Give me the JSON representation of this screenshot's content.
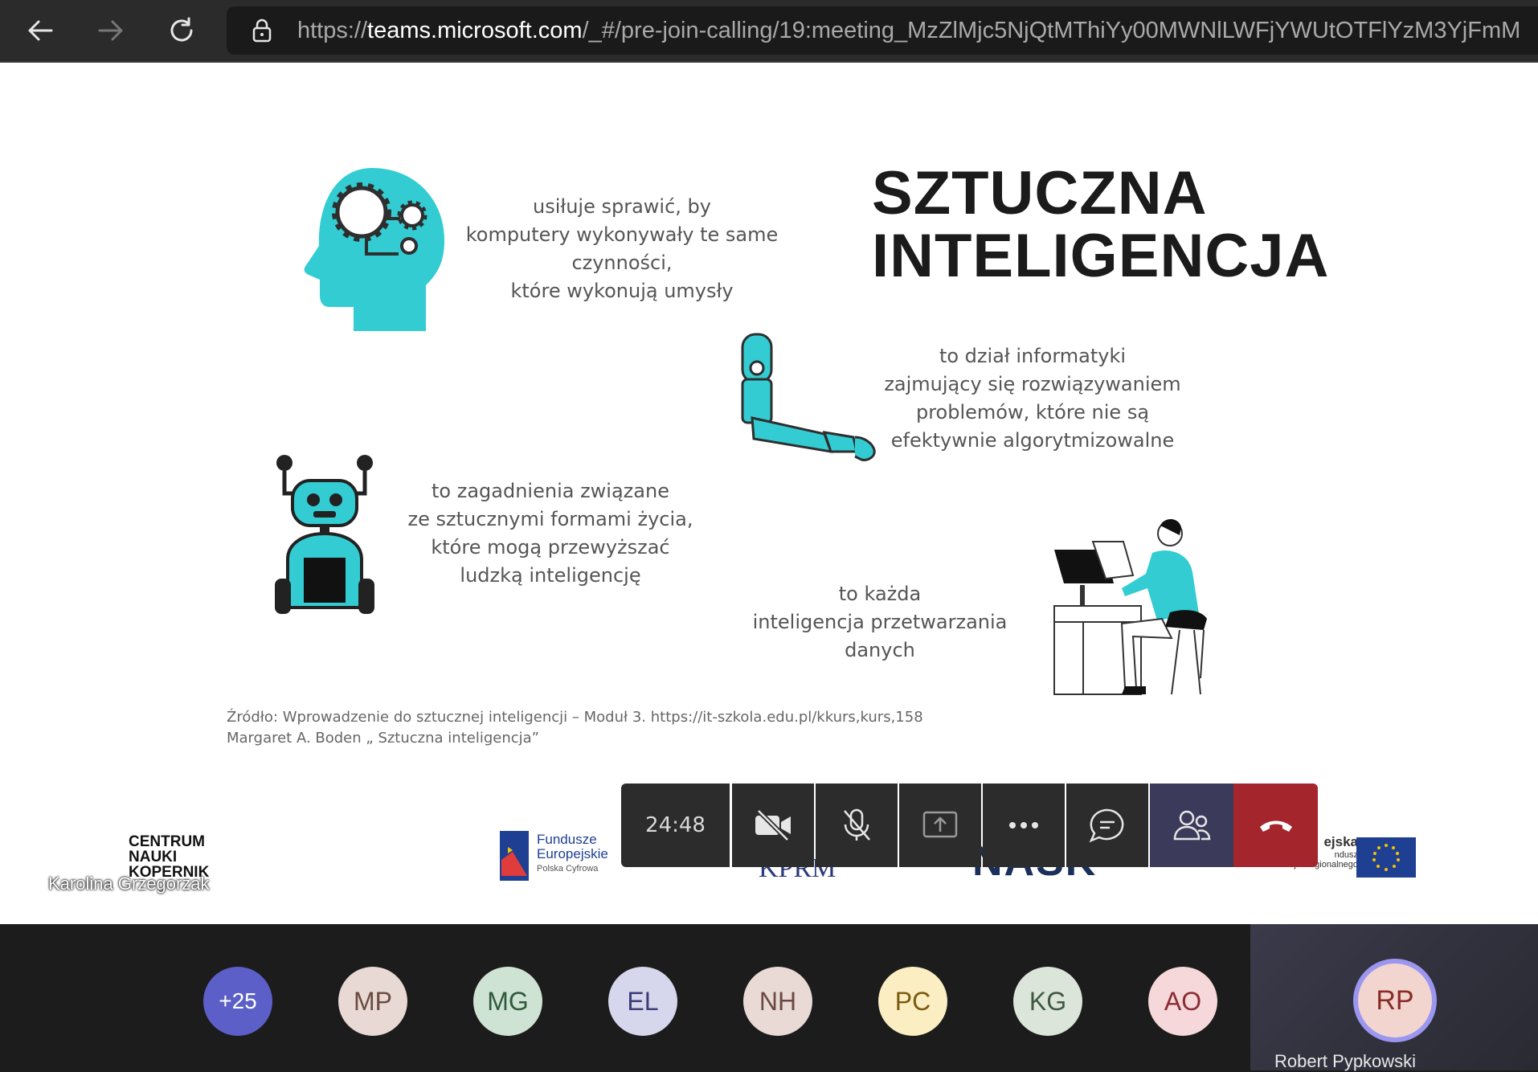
{
  "browser": {
    "url_scheme": "https://",
    "url_host": "teams.microsoft.com",
    "url_path": "/_#/pre-join-calling/19:meeting_MzZlMjc5NjQtMThiYy00MWNlLWFjYWUtOTFlYzM3YjFmM"
  },
  "slide": {
    "title_line1": "SZTUCZNA",
    "title_line2": "INTELIGENCJA",
    "text_head": [
      "usiłuje sprawić, by",
      "komputery wykonywały te same",
      "czynności,",
      "które wykonują umysły"
    ],
    "text_arm": [
      "to dział informatyki",
      "zajmujący się rozwiązywaniem",
      "problemów, które nie są",
      "efektywnie algorytmizowalne"
    ],
    "text_robot": [
      "to zagadnienia związane",
      "ze sztucznymi formami życia,",
      "które mogą przewyższać",
      "ludzką inteligencję"
    ],
    "text_person": [
      "to każda",
      "inteligencja przetwarzania",
      "danych"
    ],
    "source_line1": "Źródło: Wprowadzenie do sztucznej inteligencji – Moduł 3. https://it-szkola.edu.pl/kkurs,kurs,158",
    "source_line2": "Margaret A. Boden „ Sztuczna inteligencja”",
    "logo_cnk": [
      "CENTRUM",
      "NAUKI",
      "KOPERNIK"
    ],
    "logo_fe": [
      "Fundusze",
      "Europejskie",
      "Polska Cyfrowa"
    ],
    "logo_kprm": "KPRM",
    "logo_nask": "NASK",
    "logo_eu": [
      "ejska",
      "ndusz",
      "Rozwoju Regionalnego"
    ],
    "presenter_name": "Karolina Grzegorzak"
  },
  "controls": {
    "timer": "24:48",
    "icons": [
      "camera-off-icon",
      "mic-off-icon",
      "share-screen-icon",
      "more-options-icon",
      "chat-icon",
      "participants-icon",
      "hang-up-icon"
    ],
    "hangup_color": "#a4262c",
    "active_color": "#3b3a5a"
  },
  "participants": {
    "overflow": "+25",
    "avatars": [
      {
        "initials": "MP",
        "bg": "#e8d9d4",
        "fg": "#6b4b40"
      },
      {
        "initials": "MG",
        "bg": "#cfe3d4",
        "fg": "#2f5a3b"
      },
      {
        "initials": "EL",
        "bg": "#d6d6ec",
        "fg": "#3d3d78"
      },
      {
        "initials": "NH",
        "bg": "#e9dad6",
        "fg": "#6b4a42"
      },
      {
        "initials": "PC",
        "bg": "#fbeec3",
        "fg": "#7a5a10"
      },
      {
        "initials": "KG",
        "bg": "#dce5da",
        "fg": "#3f5840"
      },
      {
        "initials": "AO",
        "bg": "#f6d8da",
        "fg": "#8a2b33"
      }
    ],
    "self_initials": "RP",
    "self_name": "Robert Pypkowski"
  }
}
